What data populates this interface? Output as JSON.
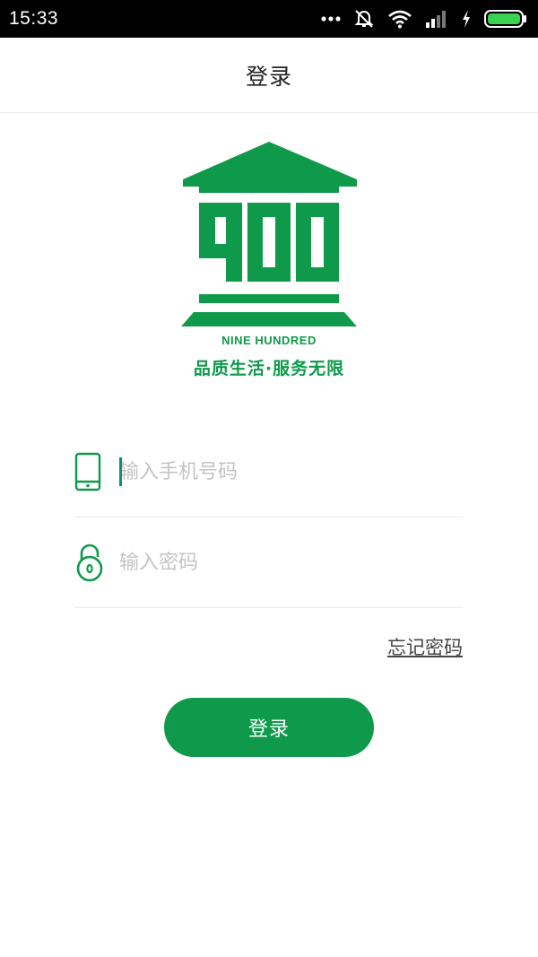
{
  "status_bar": {
    "time": "15:33",
    "icons": [
      "more-dots-icon",
      "mute-icon",
      "wifi-icon",
      "signal-icon",
      "charging-icon",
      "battery-icon"
    ]
  },
  "header": {
    "title": "登录"
  },
  "logo": {
    "number": "900",
    "brand_en": "NINE HUNDRED",
    "slogan": "品质生活·服务无限",
    "color": "#0e9a4a"
  },
  "form": {
    "phone": {
      "placeholder": "输入手机号码",
      "value": "",
      "icon": "phone-icon"
    },
    "password": {
      "placeholder": "输入密码",
      "value": "",
      "icon": "lock-icon"
    }
  },
  "forgot_label": "忘记密码",
  "login_label": "登录",
  "colors": {
    "accent": "#0e9a4a",
    "status_bar": "#000000",
    "battery": "#39d353"
  }
}
